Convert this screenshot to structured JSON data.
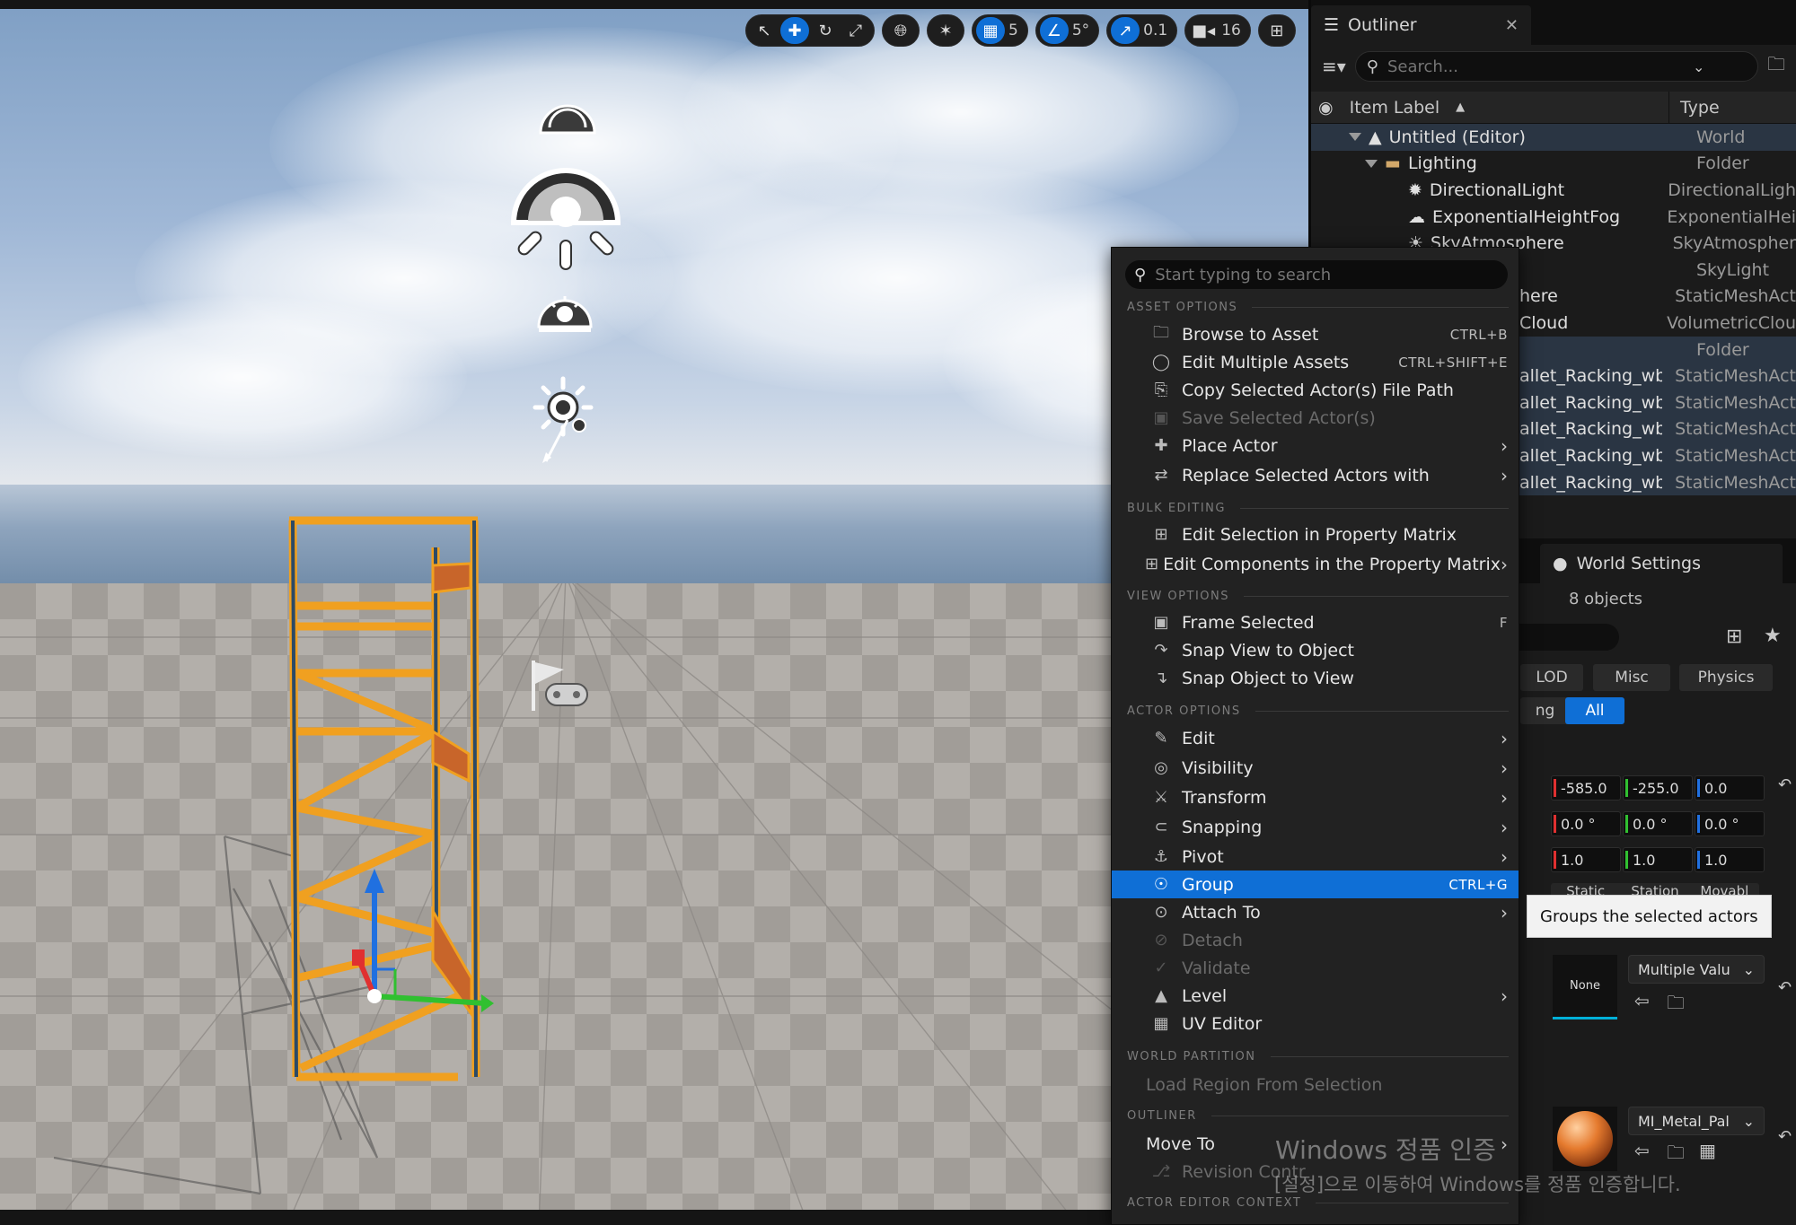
{
  "viewport": {
    "toolbar": {
      "grid_snap_value": "5",
      "rotation_snap_value": "5°",
      "scale_snap_value": "0.1",
      "camera_speed_value": "16"
    }
  },
  "outliner": {
    "tab_label": "Outliner",
    "search_placeholder": "Search...",
    "columns": {
      "label": "Item Label",
      "type": "Type"
    },
    "rows": [
      {
        "label": "Untitled (Editor)",
        "type": "World"
      },
      {
        "label": "Lighting",
        "type": "Folder"
      },
      {
        "label": "DirectionalLight",
        "type": "DirectionalLigh"
      },
      {
        "label": "ExponentialHeightFog",
        "type": "ExponentialHei"
      },
      {
        "label": "SkyAtmosphere",
        "type": "SkyAtmospher"
      },
      {
        "label": "",
        "type": "SkyLight"
      },
      {
        "label": "here",
        "type": "StaticMeshAct"
      },
      {
        "label": "Cloud",
        "type": "VolumetricClou"
      },
      {
        "label": "",
        "type": "Folder"
      },
      {
        "label": "allet_Racking_wbsla",
        "type": "StaticMeshAct"
      },
      {
        "label": "allet_Racking_wbsla",
        "type": "StaticMeshAct"
      },
      {
        "label": "allet_Racking_wbsla",
        "type": "StaticMeshAct"
      },
      {
        "label": "allet_Racking_wbsla",
        "type": "StaticMeshAct"
      },
      {
        "label": "allet_Racking_wbsla",
        "type": "StaticMeshAct"
      }
    ]
  },
  "details": {
    "world_settings_tab": "World Settings",
    "objects_count": "8 objects",
    "categories": {
      "lod": "LOD",
      "misc": "Misc",
      "physics": "Physics",
      "partial": "ng",
      "all": "All"
    },
    "location": [
      "-585.0",
      "-255.0",
      "0.0"
    ],
    "rotation": [
      "0.0 °",
      "0.0 °",
      "0.0 °"
    ],
    "scale": [
      "1.0",
      "1.0",
      "1.0"
    ],
    "mobility": [
      "Static",
      "Station",
      "Movabl"
    ],
    "mesh_thumb_label": "None",
    "mesh_dropdown": "Multiple Valu",
    "material_dropdown": "MI_Metal_Pal"
  },
  "context_menu": {
    "search_placeholder": "Start typing to search",
    "sections": {
      "asset_options": "ASSET OPTIONS",
      "bulk_editing": "BULK EDITING",
      "view_options": "VIEW OPTIONS",
      "actor_options": "ACTOR OPTIONS",
      "world_partition": "WORLD PARTITION",
      "outliner": "OUTLINER",
      "actor_editor_context": "ACTOR EDITOR CONTEXT"
    },
    "items": {
      "browse_to_asset": {
        "label": "Browse to Asset",
        "shortcut": "CTRL+B"
      },
      "edit_multiple_assets": {
        "label": "Edit Multiple Assets",
        "shortcut": "CTRL+SHIFT+E"
      },
      "copy_file_path": {
        "label": "Copy Selected Actor(s) File Path"
      },
      "save_selected_actors": {
        "label": "Save Selected Actor(s)"
      },
      "place_actor": {
        "label": "Place Actor"
      },
      "replace_selected_actors": {
        "label": "Replace Selected Actors with"
      },
      "edit_selection_matrix": {
        "label": "Edit Selection in Property Matrix"
      },
      "edit_components_matrix": {
        "label": "Edit Components in the Property Matrix"
      },
      "frame_selected": {
        "label": "Frame Selected",
        "shortcut": "F"
      },
      "snap_view_to_object": {
        "label": "Snap View to Object"
      },
      "snap_object_to_view": {
        "label": "Snap Object to View"
      },
      "edit": {
        "label": "Edit"
      },
      "visibility": {
        "label": "Visibility"
      },
      "transform": {
        "label": "Transform"
      },
      "snapping": {
        "label": "Snapping"
      },
      "pivot": {
        "label": "Pivot"
      },
      "group": {
        "label": "Group",
        "shortcut": "CTRL+G"
      },
      "attach_to": {
        "label": "Attach To"
      },
      "detach": {
        "label": "Detach"
      },
      "validate": {
        "label": "Validate"
      },
      "level": {
        "label": "Level"
      },
      "uv_editor": {
        "label": "UV Editor"
      },
      "load_region": {
        "label": "Load Region From Selection"
      },
      "move_to": {
        "label": "Move To"
      },
      "revision_control": {
        "label": "Revision Contr"
      }
    }
  },
  "tooltip": {
    "text": "Groups the selected actors"
  },
  "watermark": {
    "line1": "Windows 정품 인증",
    "line2": "[설정]으로 이동하여 Windows를 정품 인증합니다."
  },
  "colors": {
    "highlight": "#0f6fd6",
    "rack_orange": "#f0a020",
    "rack_blue": "#2c4a66",
    "axis_x": "#e03030",
    "axis_y": "#30c030",
    "axis_z": "#2070e0"
  }
}
